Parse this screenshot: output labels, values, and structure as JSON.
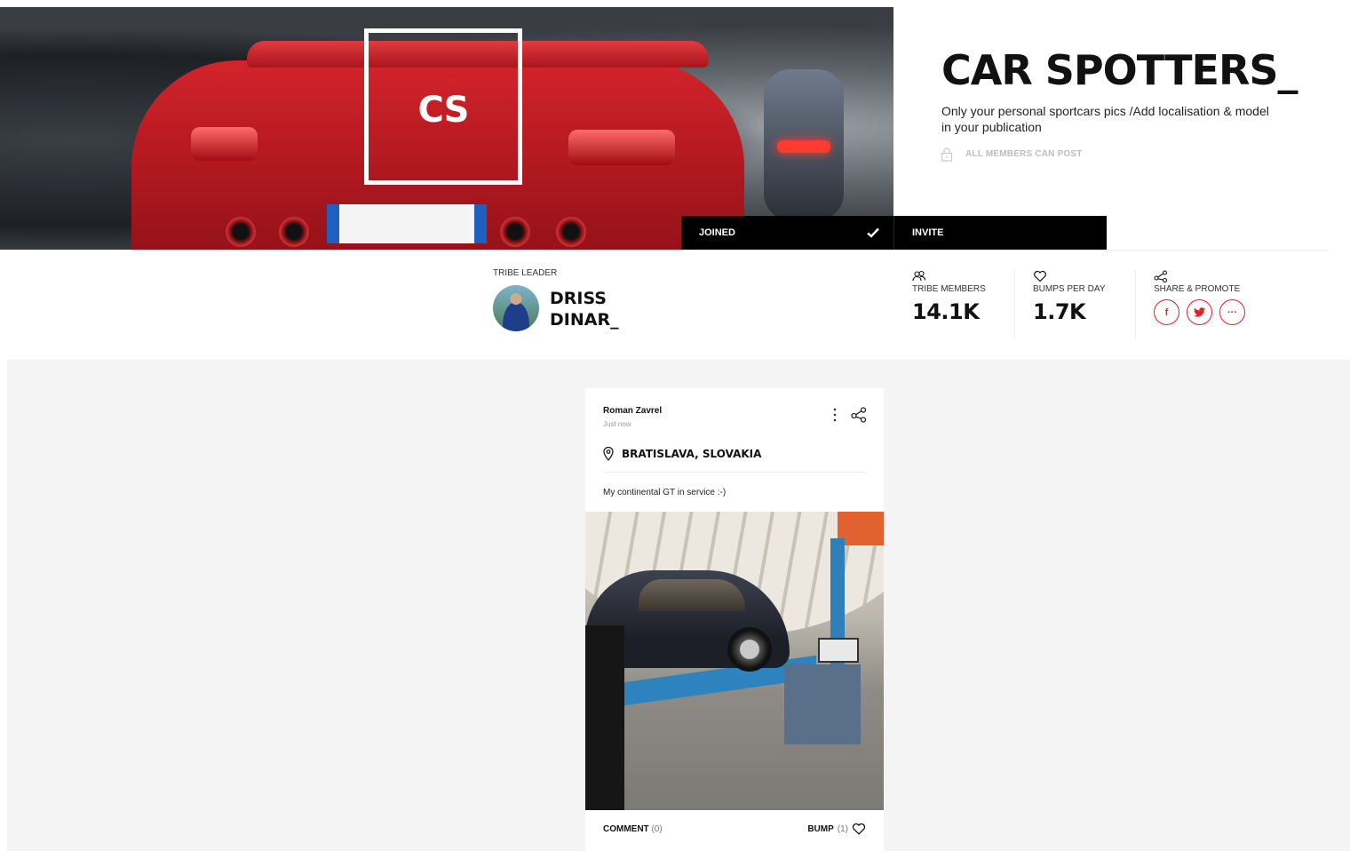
{
  "hero": {
    "logo_text": "CS"
  },
  "tribe": {
    "title": "CAR SPOTTERS_",
    "description": "Only your personal sportcars pics /Add localisation & model in your publication",
    "permission": "ALL MEMBERS CAN POST"
  },
  "actions": {
    "joined_label": "JOINED",
    "invite_label": "INVITE"
  },
  "leader": {
    "label": "TRIBE LEADER",
    "name_line1": "DRISS",
    "name_line2": "DINAR_"
  },
  "stats": {
    "members_label": "TRIBE MEMBERS",
    "members_value": "14.1K",
    "bumps_label": "BUMPS PER DAY",
    "bumps_value": "1.7K",
    "share_label": "SHARE & PROMOTE",
    "share_buttons": [
      "f",
      "t",
      "···"
    ]
  },
  "post": {
    "author": "Roman Zavrel",
    "time": "Just now",
    "location": "BRATISLAVA, SLOVAKIA",
    "text": "My continental GT in service :-)",
    "comment_label": "COMMENT",
    "comment_count": "(0)",
    "bump_label": "BUMP",
    "bump_count": "(1)"
  },
  "colors": {
    "accent": "#e2232a",
    "bar": "#000000",
    "feed_bg": "#f4f4f4"
  }
}
